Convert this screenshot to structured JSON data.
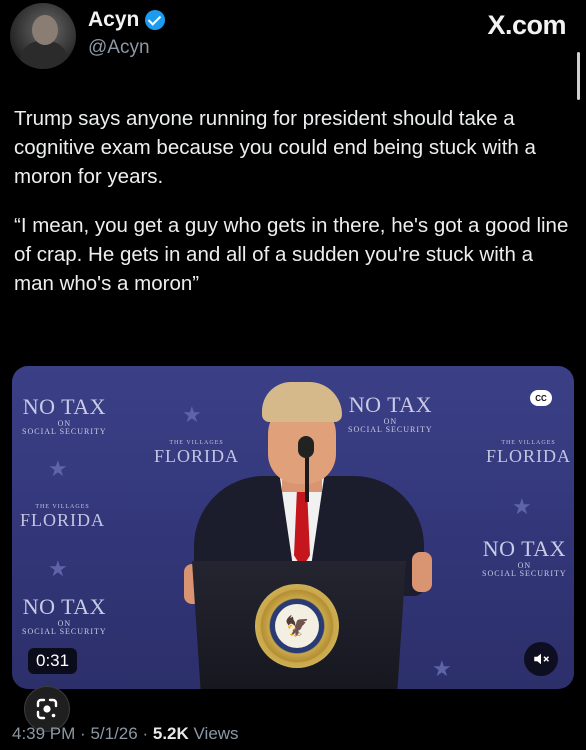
{
  "author": {
    "name": "Acyn",
    "handle": "@Acyn",
    "verified": true
  },
  "site_label": "X.com",
  "tweet": {
    "paragraphs": [
      "Trump says anyone running for president should take a cognitive exam because you could end being stuck with a moron for years.",
      "“I mean, you get a guy who gets in there, he's got a good line of crap. He gets in and all of a sudden you're stuck with a man who's a moron”"
    ]
  },
  "media": {
    "signs": {
      "no_tax": "NO TAX",
      "on": "ON",
      "social_security": "SOCIAL SECURITY",
      "the_villages": "THE VILLAGES",
      "florida": "FLORIDA"
    },
    "duration": "0:31",
    "cc_label": "CC"
  },
  "meta": {
    "time": "4:39 PM",
    "date": "5/1/26",
    "views_count": "5.2K",
    "views_label": "Views",
    "separator": "·"
  },
  "icons": {
    "verified": "verified-badge-icon",
    "cc": "closed-captions-icon",
    "mute": "mute-icon",
    "lens": "google-lens-icon"
  },
  "colors": {
    "background": "#000000",
    "accent": "#1d9bf0",
    "muted_text": "#8b98a5",
    "media_bg": "#33377a"
  }
}
